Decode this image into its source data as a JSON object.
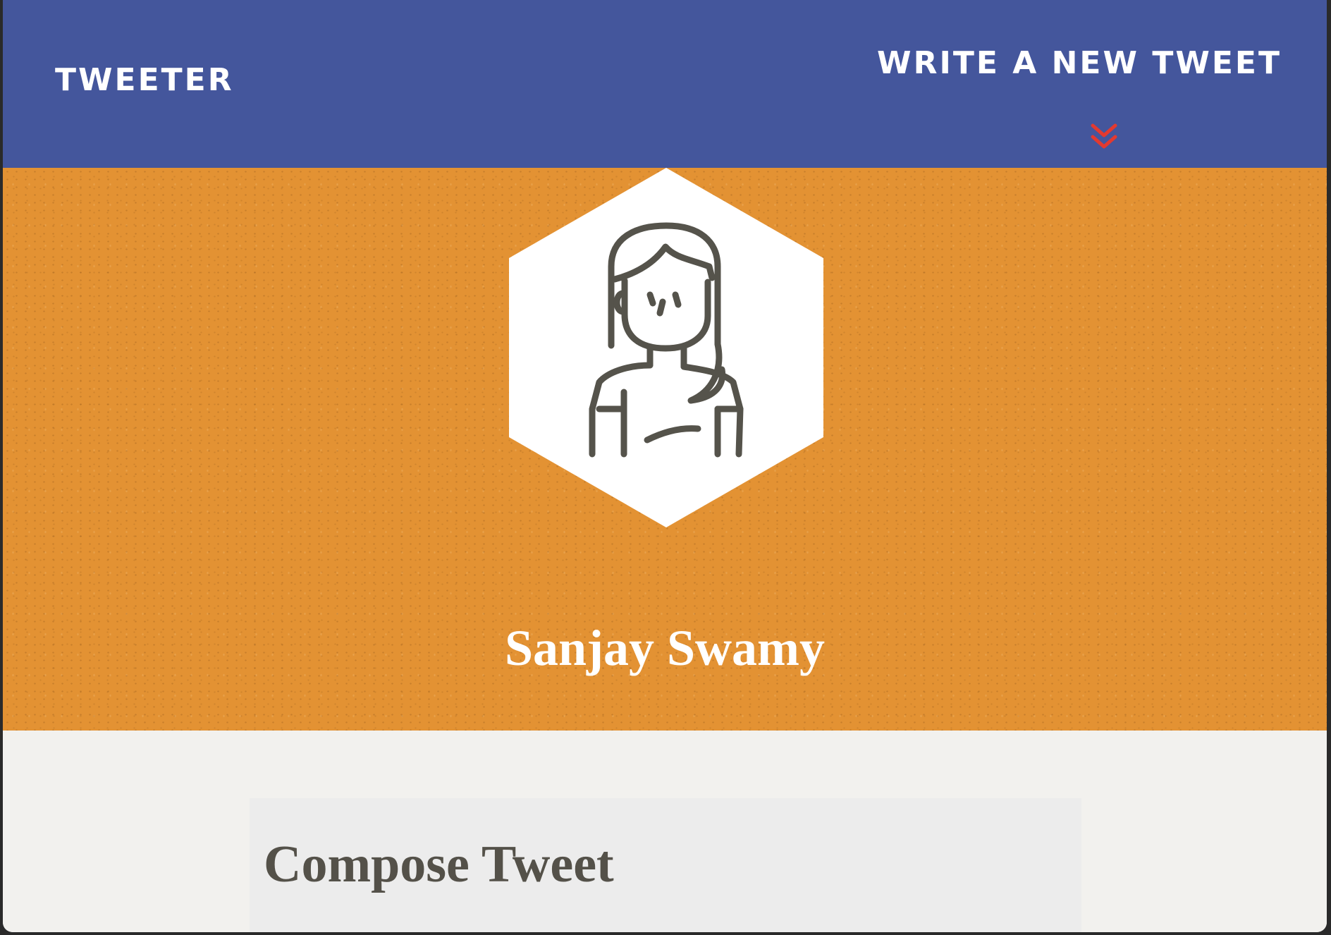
{
  "nav": {
    "brand": "Tweeter",
    "compose_toggle_label": "Write a new tweet",
    "toggle_icon": "double-chevron-down-icon",
    "toggle_icon_color": "#e3392f"
  },
  "profile": {
    "name": "Sanjay Swamy",
    "avatar_icon": "user-avatar-icon"
  },
  "compose": {
    "title": "Compose Tweet"
  },
  "colors": {
    "nav_bg": "#44569c",
    "banner_bg": "#e39233",
    "page_bg": "#f2f1ee",
    "panel_bg": "#ececec",
    "title_text": "#545149"
  }
}
